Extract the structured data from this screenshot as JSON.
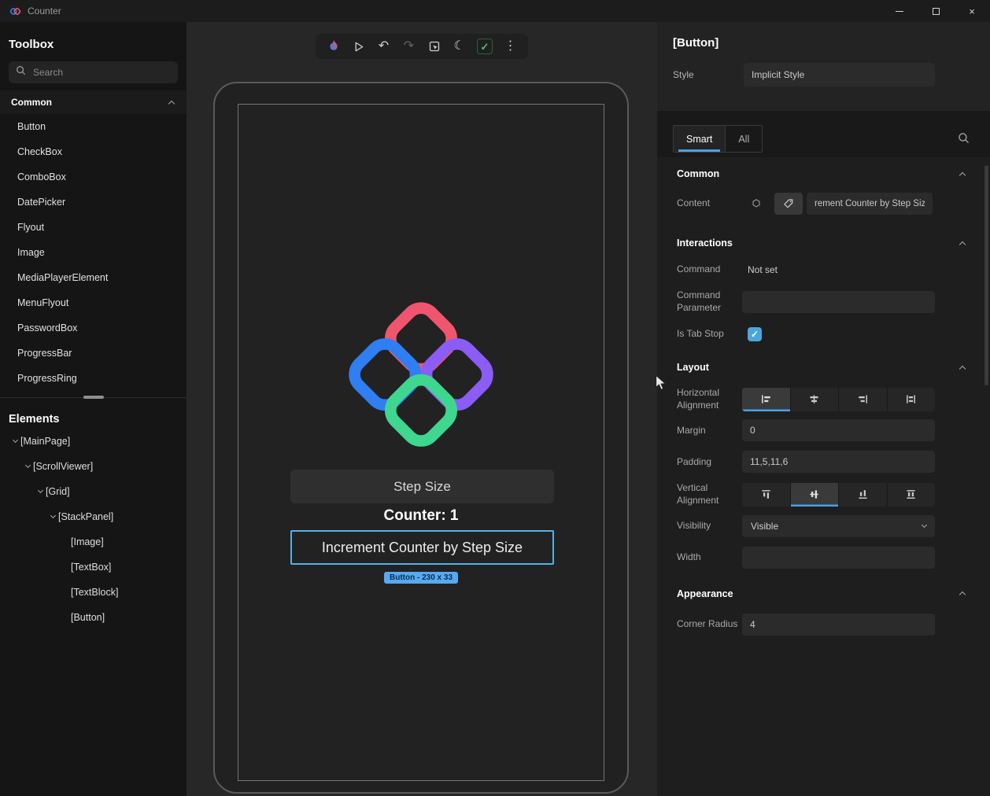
{
  "window": {
    "title": "Counter"
  },
  "icons": {
    "undo": "↶",
    "redo": "↷",
    "moon": "☾",
    "check": "✓",
    "more": "⋮",
    "close": "×"
  },
  "toolbox": {
    "title": "Toolbox",
    "search_placeholder": "Search",
    "section_label": "Common",
    "items": [
      "Button",
      "CheckBox",
      "ComboBox",
      "DatePicker",
      "Flyout",
      "Image",
      "MediaPlayerElement",
      "MenuFlyout",
      "PasswordBox",
      "ProgressBar",
      "ProgressRing"
    ]
  },
  "elements_panel": {
    "title": "Elements",
    "tree": [
      "[MainPage]",
      "[ScrollViewer]",
      "[Grid]",
      "[StackPanel]",
      "[Image]",
      "[TextBox]",
      "[TextBlock]",
      "[Button]"
    ]
  },
  "canvas": {
    "textbox_text": "Step Size",
    "counter_text": "Counter: 1",
    "button_label": "Increment Counter by Step Size",
    "selection_badge": "Button - 230 x 33"
  },
  "inspector": {
    "title": "[Button]",
    "style_label": "Style",
    "style_value": "Implicit Style",
    "tab_smart": "Smart",
    "tab_all": "All",
    "common": {
      "title": "Common",
      "content_label": "Content",
      "content_value": "rement Counter by Step Size"
    },
    "interactions": {
      "title": "Interactions",
      "command_label": "Command",
      "command_value": "Not set",
      "command_parameter_label": "Command Parameter",
      "is_tab_stop_label": "Is Tab Stop"
    },
    "layout": {
      "title": "Layout",
      "horizontal_alignment_label": "Horizontal Alignment",
      "margin_label": "Margin",
      "margin_value": "0",
      "padding_label": "Padding",
      "padding_value": "11,5,11,6",
      "vertical_alignment_label": "Vertical Alignment",
      "visibility_label": "Visibility",
      "visibility_value": "Visible",
      "width_label": "Width",
      "width_value": ""
    },
    "appearance": {
      "title": "Appearance",
      "corner_radius_label": "Corner Radius",
      "corner_radius_value": "4"
    }
  },
  "colors": {
    "accent": "#4ba0e8",
    "selection_border": "#53b1e6",
    "badge_bg": "#55aaf2",
    "checkbox": "#4da6d9",
    "logo_pink": "#f0556e",
    "logo_blue": "#2f7ef2",
    "logo_purple": "#8b5cf6",
    "logo_green": "#3fd68f"
  }
}
